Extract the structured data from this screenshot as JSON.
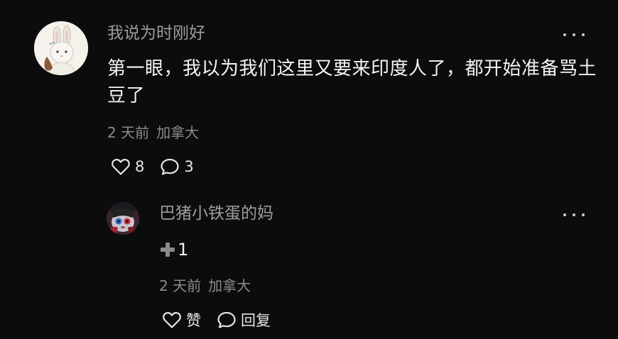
{
  "comment": {
    "username": "我说为时刚好",
    "text": "第一眼，我以为我们这里又要来印度人了，都开始准备骂土豆了",
    "time": "2 天前",
    "location": "加拿大",
    "likes": "8",
    "replies": "3",
    "avatar_icon": "rabbit-avatar",
    "more_icon": "ellipsis-icon"
  },
  "reply": {
    "username": "巴猪小铁蛋的妈",
    "text_prefix_icon": "plus-icon",
    "text": "1",
    "time": "2 天前",
    "location": "加拿大",
    "like_label": "赞",
    "reply_label": "回复",
    "avatar_icon": "character-avatar",
    "more_icon": "ellipsis-icon"
  },
  "colors": {
    "background": "#0c0c0c",
    "username": "#9d9d9d",
    "text": "#f4f4f4",
    "meta": "#8c8c8c"
  }
}
